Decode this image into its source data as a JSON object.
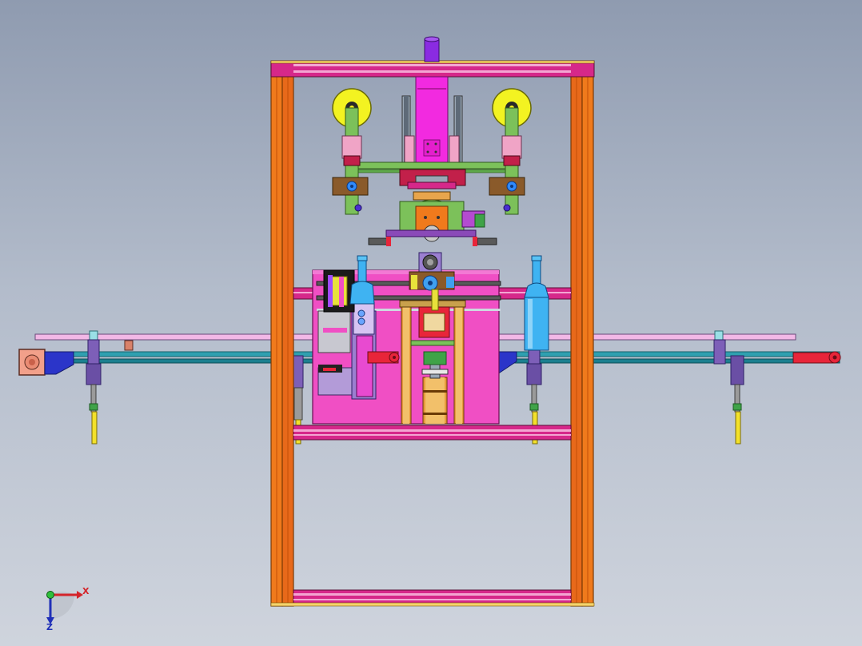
{
  "view": {
    "background_top": "#8f9bb0",
    "background_bottom": "#cfd4dd"
  },
  "colors": {
    "frame_orange": "#f07a1c",
    "frame_orange_dark": "#c24f08",
    "beam_magenta": "#d6288a",
    "beam_stripe": "#f3a6d2",
    "plate_pink": "#f04fc4",
    "rail_cyan": "#2fa0b0",
    "rail_pink": "#f2b8e6",
    "wheel_yellow": "#f3f321",
    "arm_green": "#7cc15a",
    "cylinder_magenta": "#f22ae0",
    "post_purple": "#8a2be2",
    "bottle_blue": "#3fb3f2",
    "leg_yellow": "#f3e12b",
    "bracket_purple": "#7d5fb8",
    "motor_salmon": "#f2a08a",
    "red_part": "#e8253a"
  },
  "triad": {
    "x_label": "X",
    "z_label": "Z",
    "x_color": "#d4242a",
    "y_color": "#2fbf3b",
    "z_color": "#1f2fb8"
  }
}
